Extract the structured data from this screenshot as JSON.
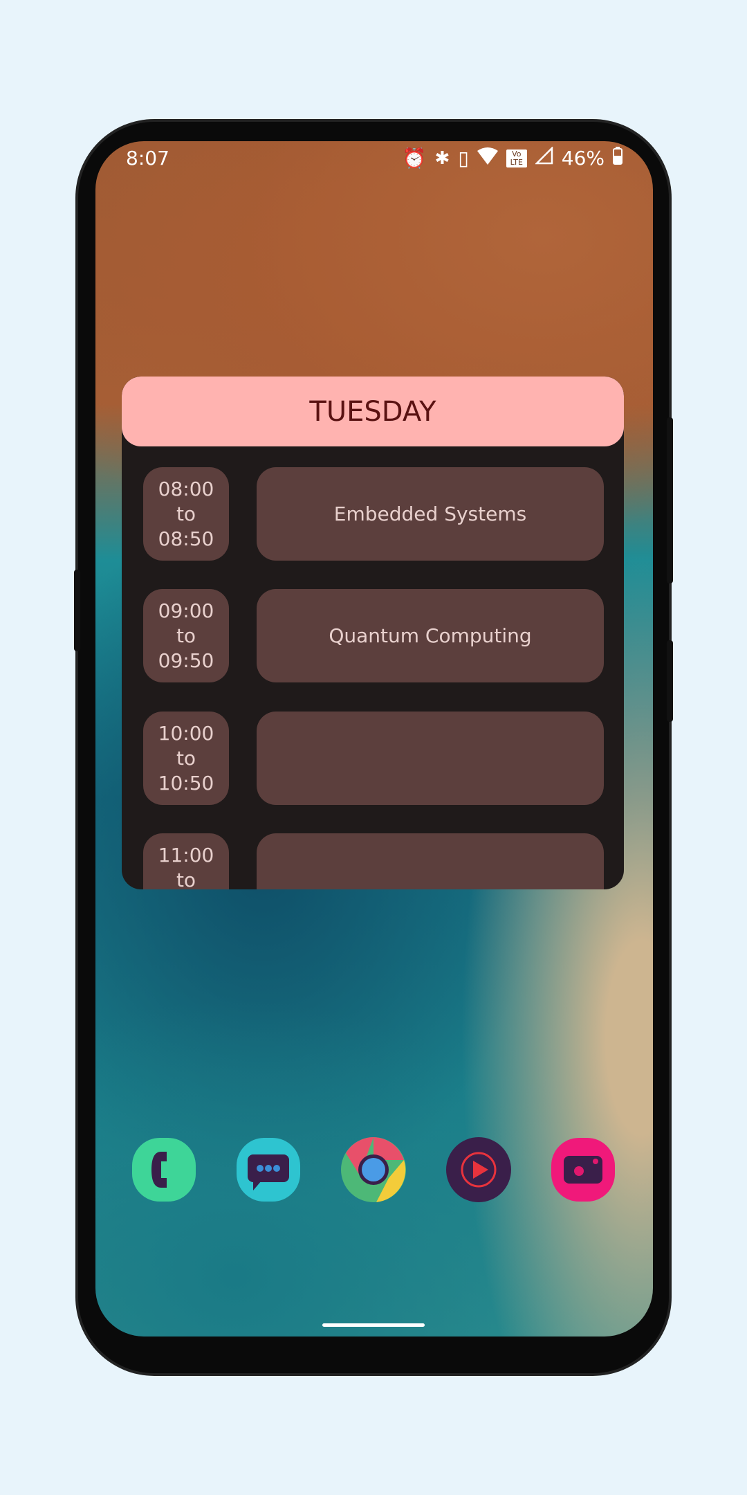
{
  "status_bar": {
    "time": "8:07",
    "battery": "46%",
    "icons": [
      "alarm-icon",
      "bluetooth-icon",
      "vibrate-icon",
      "wifi-icon",
      "volte-icon",
      "signal-icon",
      "battery-icon"
    ],
    "volte_label": "Vo LTE"
  },
  "widget": {
    "day": "TUESDAY",
    "slots": [
      {
        "start": "08:00",
        "sep": "to",
        "end": "08:50",
        "subject": "Embedded Systems"
      },
      {
        "start": "09:00",
        "sep": "to",
        "end": "09:50",
        "subject": "Quantum Computing"
      },
      {
        "start": "10:00",
        "sep": "to",
        "end": "10:50",
        "subject": ""
      },
      {
        "start": "11:00",
        "sep": "to",
        "end": "",
        "subject": ""
      }
    ],
    "colors": {
      "header": "#ffb3b0",
      "cell": "#5c3f3d",
      "background": "#1f1a1a"
    }
  },
  "dock": {
    "apps": [
      "phone-icon",
      "messages-icon",
      "chrome-icon",
      "music-player-icon",
      "camera-icon"
    ]
  }
}
